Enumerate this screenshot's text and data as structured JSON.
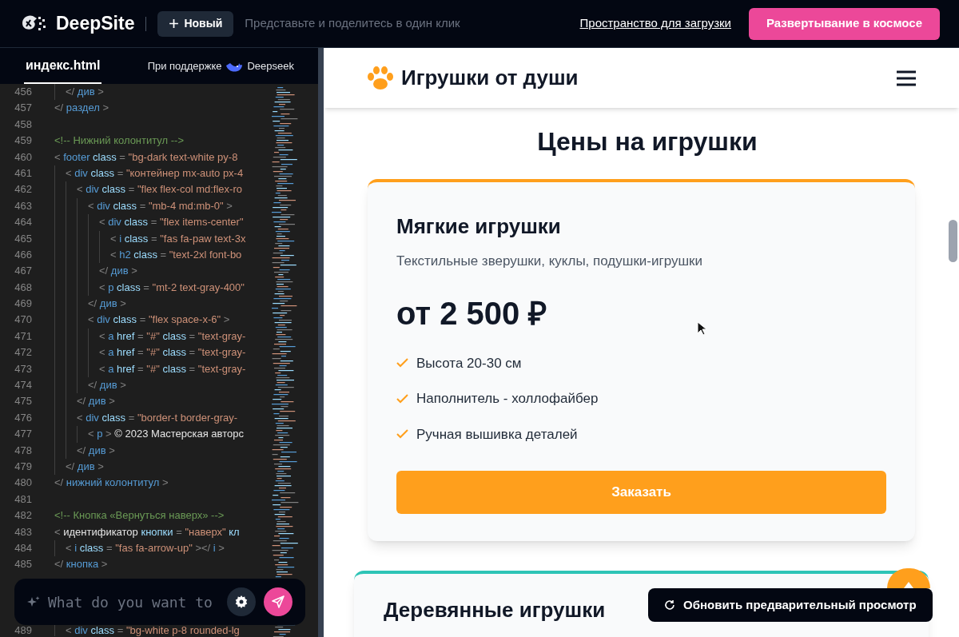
{
  "header": {
    "logo_text": "DeepSite",
    "new_button": "Новый",
    "tagline": "Представьте и поделитесь в один клик",
    "link": "Пространство для загрузки",
    "deploy_button": "Развертывание в космосе"
  },
  "editor": {
    "tabs": [
      {
        "label": "индекс.html",
        "selected": true
      }
    ],
    "powered_by": "При поддержке",
    "provider": "Deepseek",
    "lines": [
      {
        "children": [
          {
            "n": "456",
            "tokens": [
              {
                "kind": "punct",
                "text": "</ "
              },
              {
                "kind": "tag",
                "text": "див"
              },
              {
                "kind": "punct",
                "text": " >"
              }
            ]
          }
        ]
      },
      {
        "n": "457",
        "tokens": [
          {
            "kind": "punct",
            "text": "</ "
          },
          {
            "kind": "tag",
            "text": "раздел"
          },
          {
            "kind": "punct",
            "text": " >"
          }
        ]
      },
      {
        "n": "458"
      },
      {
        "n": "459",
        "tokens": [
          {
            "kind": "comment",
            "text": "<!-- Нижний колонтитул -->"
          }
        ]
      },
      {
        "n": "460",
        "tokens": [
          {
            "kind": "punct",
            "text": "< "
          },
          {
            "kind": "tag",
            "text": "footer"
          },
          {
            "kind": "attr",
            "text": " class"
          },
          {
            "kind": "punct",
            "text": " = "
          },
          {
            "kind": "string",
            "text": "\"bg-dark text-white py-8"
          }
        ],
        "children": [
          {
            "n": "461",
            "tokens": [
              {
                "kind": "punct",
                "text": "< "
              },
              {
                "kind": "tag",
                "text": "div"
              },
              {
                "kind": "attr",
                "text": " class"
              },
              {
                "kind": "punct",
                "text": " = "
              },
              {
                "kind": "string",
                "text": "\"контейнер mx-auto px-4"
              }
            ],
            "children": [
              {
                "n": "462",
                "tokens": [
                  {
                    "kind": "punct",
                    "text": "< "
                  },
                  {
                    "kind": "tag",
                    "text": "div"
                  },
                  {
                    "kind": "attr",
                    "text": " class"
                  },
                  {
                    "kind": "punct",
                    "text": " = "
                  },
                  {
                    "kind": "string",
                    "text": "\"flex flex-col md:flex-ro"
                  }
                ],
                "children": [
                  {
                    "n": "463",
                    "tokens": [
                      {
                        "kind": "punct",
                        "text": "< "
                      },
                      {
                        "kind": "tag",
                        "text": "div"
                      },
                      {
                        "kind": "attr",
                        "text": " class"
                      },
                      {
                        "kind": "punct",
                        "text": " = "
                      },
                      {
                        "kind": "string",
                        "text": "\"mb-4 md:mb-0\""
                      },
                      {
                        "kind": "punct",
                        "text": " >"
                      }
                    ],
                    "children": [
                      {
                        "n": "464",
                        "tokens": [
                          {
                            "kind": "punct",
                            "text": "< "
                          },
                          {
                            "kind": "tag",
                            "text": "div"
                          },
                          {
                            "kind": "attr",
                            "text": " class"
                          },
                          {
                            "kind": "punct",
                            "text": " = "
                          },
                          {
                            "kind": "string",
                            "text": "\"flex items-center\""
                          }
                        ],
                        "children": [
                          {
                            "n": "465",
                            "tokens": [
                              {
                                "kind": "punct",
                                "text": "< "
                              },
                              {
                                "kind": "tag",
                                "text": "i"
                              },
                              {
                                "kind": "attr",
                                "text": " class"
                              },
                              {
                                "kind": "punct",
                                "text": " = "
                              },
                              {
                                "kind": "string",
                                "text": "\"fas fa-paw text-3x"
                              }
                            ]
                          },
                          {
                            "n": "466",
                            "tokens": [
                              {
                                "kind": "punct",
                                "text": "< "
                              },
                              {
                                "kind": "tag",
                                "text": "h2"
                              },
                              {
                                "kind": "attr",
                                "text": " class"
                              },
                              {
                                "kind": "punct",
                                "text": " = "
                              },
                              {
                                "kind": "string",
                                "text": "\"text-2xl font-bo"
                              }
                            ]
                          }
                        ]
                      },
                      {
                        "n": "467",
                        "tokens": [
                          {
                            "kind": "punct",
                            "text": "</ "
                          },
                          {
                            "kind": "tag",
                            "text": "див"
                          },
                          {
                            "kind": "punct",
                            "text": " >"
                          }
                        ]
                      },
                      {
                        "n": "468",
                        "tokens": [
                          {
                            "kind": "punct",
                            "text": "< "
                          },
                          {
                            "kind": "tag",
                            "text": "p"
                          },
                          {
                            "kind": "attr",
                            "text": " class"
                          },
                          {
                            "kind": "punct",
                            "text": " = "
                          },
                          {
                            "kind": "string",
                            "text": "\"mt-2 text-gray-400\""
                          }
                        ]
                      }
                    ]
                  },
                  {
                    "n": "469",
                    "tokens": [
                      {
                        "kind": "punct",
                        "text": "</ "
                      },
                      {
                        "kind": "tag",
                        "text": "див"
                      },
                      {
                        "kind": "punct",
                        "text": " >"
                      }
                    ]
                  },
                  {
                    "n": "470",
                    "tokens": [
                      {
                        "kind": "punct",
                        "text": "< "
                      },
                      {
                        "kind": "tag",
                        "text": "div"
                      },
                      {
                        "kind": "attr",
                        "text": " class"
                      },
                      {
                        "kind": "punct",
                        "text": " = "
                      },
                      {
                        "kind": "string",
                        "text": "\"flex space-x-6\""
                      },
                      {
                        "kind": "punct",
                        "text": " >"
                      }
                    ],
                    "children": [
                      {
                        "n": "471",
                        "tokens": [
                          {
                            "kind": "punct",
                            "text": "< "
                          },
                          {
                            "kind": "tag",
                            "text": "a"
                          },
                          {
                            "kind": "attr",
                            "text": " href"
                          },
                          {
                            "kind": "punct",
                            "text": " = "
                          },
                          {
                            "kind": "string",
                            "text": "\"#\""
                          },
                          {
                            "kind": "attr",
                            "text": " class"
                          },
                          {
                            "kind": "punct",
                            "text": " = "
                          },
                          {
                            "kind": "string",
                            "text": "\"text-gray-"
                          }
                        ]
                      },
                      {
                        "n": "472",
                        "tokens": [
                          {
                            "kind": "punct",
                            "text": "< "
                          },
                          {
                            "kind": "tag",
                            "text": "a"
                          },
                          {
                            "kind": "attr",
                            "text": " href"
                          },
                          {
                            "kind": "punct",
                            "text": " = "
                          },
                          {
                            "kind": "string",
                            "text": "\"#\""
                          },
                          {
                            "kind": "attr",
                            "text": " class"
                          },
                          {
                            "kind": "punct",
                            "text": " = "
                          },
                          {
                            "kind": "string",
                            "text": "\"text-gray-"
                          }
                        ]
                      },
                      {
                        "n": "473",
                        "tokens": [
                          {
                            "kind": "punct",
                            "text": "< "
                          },
                          {
                            "kind": "tag",
                            "text": "a"
                          },
                          {
                            "kind": "attr",
                            "text": " href"
                          },
                          {
                            "kind": "punct",
                            "text": " = "
                          },
                          {
                            "kind": "string",
                            "text": "\"#\""
                          },
                          {
                            "kind": "attr",
                            "text": " class"
                          },
                          {
                            "kind": "punct",
                            "text": " = "
                          },
                          {
                            "kind": "string",
                            "text": "\"text-gray-"
                          }
                        ]
                      }
                    ]
                  },
                  {
                    "n": "474",
                    "tokens": [
                      {
                        "kind": "punct",
                        "text": "</ "
                      },
                      {
                        "kind": "tag",
                        "text": "див"
                      },
                      {
                        "kind": "punct",
                        "text": " >"
                      }
                    ]
                  }
                ]
              },
              {
                "n": "475",
                "tokens": [
                  {
                    "kind": "punct",
                    "text": "</ "
                  },
                  {
                    "kind": "tag",
                    "text": "див"
                  },
                  {
                    "kind": "punct",
                    "text": " >"
                  }
                ]
              },
              {
                "n": "476",
                "tokens": [
                  {
                    "kind": "punct",
                    "text": "< "
                  },
                  {
                    "kind": "tag",
                    "text": "div"
                  },
                  {
                    "kind": "attr",
                    "text": " class"
                  },
                  {
                    "kind": "punct",
                    "text": " = "
                  },
                  {
                    "kind": "string",
                    "text": "\"border-t border-gray-"
                  }
                ],
                "children": [
                  {
                    "n": "477",
                    "tokens": [
                      {
                        "kind": "punct",
                        "text": "< "
                      },
                      {
                        "kind": "tag",
                        "text": "p"
                      },
                      {
                        "kind": "punct",
                        "text": " > "
                      },
                      {
                        "kind": "plain",
                        "text": "© 2023 Мастерская авторс"
                      }
                    ]
                  }
                ]
              },
              {
                "n": "478",
                "tokens": [
                  {
                    "kind": "punct",
                    "text": "</ "
                  },
                  {
                    "kind": "tag",
                    "text": "див"
                  },
                  {
                    "kind": "punct",
                    "text": " >"
                  }
                ]
              }
            ]
          },
          {
            "n": "479",
            "tokens": [
              {
                "kind": "punct",
                "text": "</ "
              },
              {
                "kind": "tag",
                "text": "див"
              },
              {
                "kind": "punct",
                "text": " >"
              }
            ]
          }
        ]
      },
      {
        "n": "480",
        "tokens": [
          {
            "kind": "punct",
            "text": "</ "
          },
          {
            "kind": "tag",
            "text": "нижний колонтитул"
          },
          {
            "kind": "punct",
            "text": " >"
          }
        ]
      },
      {
        "n": "481"
      },
      {
        "n": "482",
        "tokens": [
          {
            "kind": "comment",
            "text": "<!-- Кнопка «Вернуться наверх» -->"
          }
        ]
      },
      {
        "n": "483",
        "tokens": [
          {
            "kind": "punct",
            "text": "< "
          },
          {
            "kind": "plain",
            "text": "идентификатор"
          },
          {
            "kind": "attr",
            "text": " кнопки"
          },
          {
            "kind": "punct",
            "text": " = "
          },
          {
            "kind": "string",
            "text": "\"наверх\""
          },
          {
            "kind": "attr",
            "text": " кл"
          }
        ],
        "children": [
          {
            "n": "484",
            "tokens": [
              {
                "kind": "punct",
                "text": "< "
              },
              {
                "kind": "tag",
                "text": "i"
              },
              {
                "kind": "attr",
                "text": " class"
              },
              {
                "kind": "punct",
                "text": " = "
              },
              {
                "kind": "string",
                "text": "\"fas fa-arrow-up\""
              },
              {
                "kind": "punct",
                "text": " ></ "
              },
              {
                "kind": "tag",
                "text": "i"
              },
              {
                "kind": "punct",
                "text": " >"
              }
            ]
          }
        ]
      },
      {
        "n": "485",
        "tokens": [
          {
            "kind": "punct",
            "text": "</ "
          },
          {
            "kind": "tag",
            "text": "кнопка"
          },
          {
            "kind": "punct",
            "text": " >"
          }
        ]
      }
    ],
    "lines_below_prompt": [
      {
        "children": [
          {
            "n": "489",
            "tokens": [
              {
                "kind": "punct",
                "text": "< "
              },
              {
                "kind": "tag",
                "text": "div"
              },
              {
                "kind": "attr",
                "text": " class"
              },
              {
                "kind": "punct",
                "text": " = "
              },
              {
                "kind": "string",
                "text": "\"bg-white p-8 rounded-lg"
              }
            ]
          }
        ]
      }
    ],
    "prompt": {
      "placeholder": "What do you want to"
    }
  },
  "preview": {
    "brand": "Игрушки от души",
    "section_title": "Цены на игрушки",
    "cards": [
      {
        "color": "#ff9f1c",
        "title": "Мягкие игрушки",
        "description": "Текстильные зверушки, куклы, подушки-игрушки",
        "price": "от 2 500 ₽",
        "features": [
          "Высота 20-30 см",
          "Наполнитель - холлофайбер",
          "Ручная вышивка деталей"
        ],
        "button": "Заказать"
      },
      {
        "color": "#2ec4b6",
        "title": "Деревянные игрушки"
      }
    ],
    "refresh_toast": "Обновить предварительный просмотр"
  }
}
